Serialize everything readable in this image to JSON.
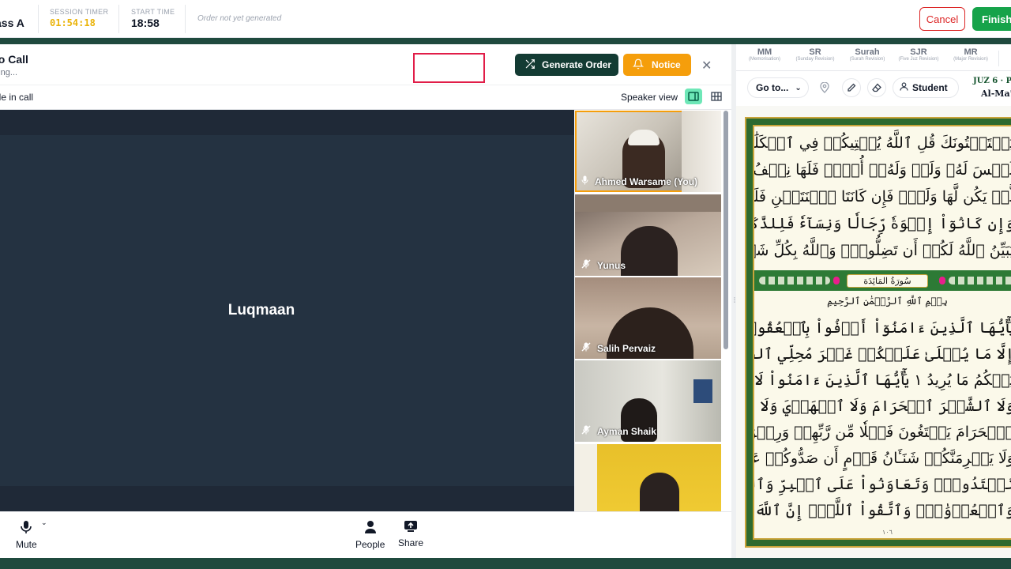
{
  "topbar": {
    "class_name": "ass A",
    "session_timer_label": "SESSION TIMER",
    "session_timer": "01:54:18",
    "start_time_label": "START TIME",
    "start_time": "18:58",
    "order_status": "Order not yet generated",
    "cancel_label": "Cancel",
    "finish_label": "Finish &"
  },
  "video": {
    "title": "eo Call",
    "subtitle": "ading...",
    "generate_order_label": "Generate Order",
    "notice_label": "Notice",
    "people_in_call": "ple in call",
    "view_label": "Speaker view",
    "speaker_name": "Luqmaan",
    "participants": [
      {
        "name": "Ahmed Warsame (You)",
        "mic": "on"
      },
      {
        "name": "Yunus",
        "mic": "muted"
      },
      {
        "name": "Salih Pervaiz",
        "mic": "muted"
      },
      {
        "name": "Ayman Shaik",
        "mic": "muted"
      },
      {
        "name": "",
        "mic": ""
      }
    ],
    "footer": {
      "mute_label": "Mute",
      "people_label": "People",
      "share_label": "Share"
    }
  },
  "quran": {
    "tabs": [
      {
        "code": "MM",
        "desc": "(Memorisation)"
      },
      {
        "code": "SR",
        "desc": "(Sunday Revision)"
      },
      {
        "code": "Surah",
        "desc": "(Surah Revision)"
      },
      {
        "code": "SJR",
        "desc": "(Five Juz Revision)"
      },
      {
        "code": "MR",
        "desc": "(Major Revision)"
      }
    ],
    "goto_label": "Go to...",
    "student_label": "Student",
    "juz_label": "JUZ 6 · P",
    "surah_en": "Al-Ma'i",
    "surah_ar": "سُورَةُ المَائِدَة",
    "bismillah": "بِسۡمِ ٱللَّهِ ٱلرَّحۡمَٰنِ ٱلرَّحِيمِ",
    "verses_top": [
      "يَسۡتَفۡتُونَكَ قُلِ ٱللَّهُ يُفۡتِيكُمۡ فِي ٱلۡكَلَٰلَةِۚ إِنِ ٱمۡرُؤٌاْ هَلَكَ",
      "لَيۡسَ لَهُۥ وَلَدٞ وَلَهُۥٓ أُخۡتٞ فَلَهَا نِصۡفُ مَا تَرَكَۚ وَهُوَ يَرِثُهَآ إِن",
      "لَّمۡ يَكُن لَّهَا وَلَدٞۚ فَإِن كَانَتَا ٱثۡنَتَيۡنِ فَلَهُمَا ٱلثُّلُثَانِ مِمَّا تَرَكَۚ",
      "وَإِن كَانُوٓاْ إِخۡوَةٗ رِّجَالٗا وَنِسَآءٗ فَلِلذَّكَرِ مِثۡلُ حَظِّ ٱلۡأُنثَيَيۡنِۗ",
      "يُبَيِّنُ ٱللَّهُ لَكُمۡ أَن تَضِلُّواْۗ وَٱللَّهُ بِكُلِّ شَيۡءٍ عَلِيمُۢ ١٧٦"
    ],
    "verses_bottom": [
      "يَٰٓأَيُّهَا ٱلَّذِينَ ءَامَنُوٓاْ أَوۡفُواْ بِٱلۡعُقُودِۚ أُحِلَّتۡ لَكُم بَهِيمَةُ ٱلۡأَنۡعَٰمِ",
      "إِلَّا مَا يُتۡلَىٰ عَلَيۡكُمۡ غَيۡرَ مُحِلِّي ٱلصَّيۡدِ وَأَنتُمۡ حُرُمٌۗ إِنَّ ٱللَّهَ",
      "يَحۡكُمُ مَا يُرِيدُ ١ يَٰٓأَيُّهَا ٱلَّذِينَ ءَامَنُواْ لَا تُحِلُّواْ شَعَٰٓئِرَ ٱللَّهِ",
      "وَلَا ٱلشَّهۡرَ ٱلۡحَرَامَ وَلَا ٱلۡهَدۡيَ وَلَا ٱلۡقَلَٰٓئِدَ وَلَآ ءَآمِّينَ ٱلۡبَيۡتَ",
      "ٱلۡحَرَامَ يَبۡتَغُونَ فَضۡلٗا مِّن رَّبِّهِمۡ وَرِضۡوَٰنٗاۚ وَإِذَا حَلَلۡتُمۡ فَٱصۡطَادُواْۚ",
      "وَلَا يَجۡرِمَنَّكُمۡ شَنَـَٔانُ قَوۡمٍ أَن صَدُّوكُمۡ عَنِ ٱلۡمَسۡجِدِ ٱلۡحَرَامِ أَن",
      "تَعۡتَدُواْۘ وَتَعَاوَنُواْ عَلَى ٱلۡبِرِّ وَٱلتَّقۡوَىٰۖ وَلَا تَعَاوَنُواْ عَلَى ٱلۡإِثۡمِ",
      "وَٱلۡعُدۡوَٰنِۚ وَٱتَّقُواْ ٱللَّهَۖ إِنَّ ٱللَّهَ شَدِيدُ ٱلۡعِقَابِ ٢"
    ],
    "page_number": "١٠٦"
  }
}
